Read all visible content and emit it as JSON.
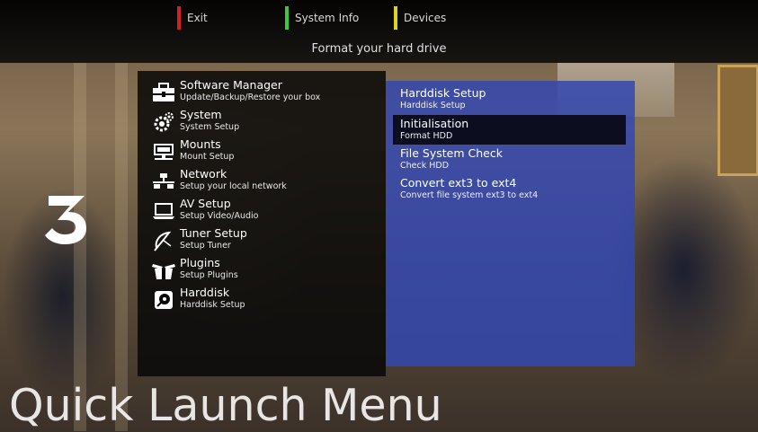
{
  "header": {
    "buttons": [
      {
        "label": "Exit",
        "color": "#d32020"
      },
      {
        "label": "System Info",
        "color": "#3cc83c"
      },
      {
        "label": "Devices",
        "color": "#e0d020"
      }
    ],
    "subtitle": "Format your hard drive"
  },
  "menu": {
    "items": [
      {
        "title": "Software Manager",
        "subtitle": "Update/Backup/Restore your box",
        "icon": "toolbox-icon"
      },
      {
        "title": "System",
        "subtitle": "System Setup",
        "icon": "gears-icon"
      },
      {
        "title": "Mounts",
        "subtitle": "Mount Setup",
        "icon": "network-folder-icon"
      },
      {
        "title": "Network",
        "subtitle": "Setup your local network",
        "icon": "network-icon"
      },
      {
        "title": "AV Setup",
        "subtitle": "Setup Video/Audio",
        "icon": "laptop-icon"
      },
      {
        "title": "Tuner Setup",
        "subtitle": "Setup Tuner",
        "icon": "satellite-dish-icon"
      },
      {
        "title": "Plugins",
        "subtitle": "Setup Plugins",
        "icon": "plugins-box-icon"
      },
      {
        "title": "Harddisk",
        "subtitle": "Harddisk Setup",
        "icon": "harddisk-icon"
      }
    ]
  },
  "submenu": {
    "items": [
      {
        "title": "Harddisk Setup",
        "subtitle": "Harddisk Setup"
      },
      {
        "title": "Initialisation",
        "subtitle": "Format HDD",
        "selected": true
      },
      {
        "title": "File System Check",
        "subtitle": "Check HDD"
      },
      {
        "title": "Convert ext3 to ext4",
        "subtitle": "Convert file system ext3 to ext4"
      }
    ]
  },
  "footer": {
    "title": "Quick Launch Menu"
  },
  "colors": {
    "submenu_bg": "#3248b0",
    "menu_bg": "#080808"
  }
}
